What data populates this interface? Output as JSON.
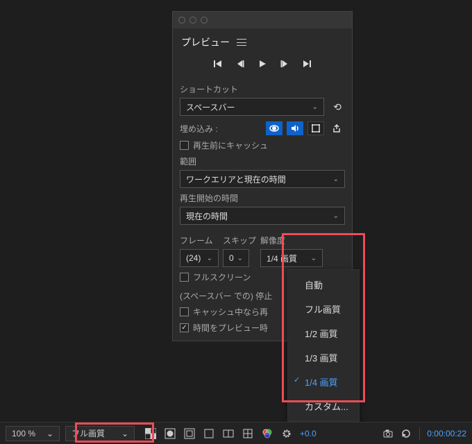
{
  "panel": {
    "title": "プレビュー",
    "shortcut": {
      "label": "ショートカット",
      "value": "スペースバー"
    },
    "embed": {
      "label": "埋め込み :",
      "cache_before_play": "再生前にキャッシュ"
    },
    "range": {
      "label": "範囲",
      "value": "ワークエリアと現在の時間"
    },
    "playfrom": {
      "label": "再生開始の時間",
      "value": "現在の時間"
    },
    "frame": {
      "label": "フレーム",
      "value": "(24)"
    },
    "skip": {
      "label": "スキップ",
      "value": "0"
    },
    "res": {
      "label": "解像度",
      "value": "1/4 画質"
    },
    "fullscreen": "フルスクリーン",
    "stop": "(スペースバー での) 停止",
    "stop_cache": "キャッシュ中なら再",
    "stop_preview": "時間をプレビュー時"
  },
  "dropdown": [
    "自動",
    "フル画質",
    "1/2 画質",
    "1/3 画質",
    "1/4 画質",
    "カスタム..."
  ],
  "footer": {
    "zoom": "100 %",
    "res": "フル画質",
    "exposure": "+0.0",
    "timecode": "0:00:00:22"
  }
}
